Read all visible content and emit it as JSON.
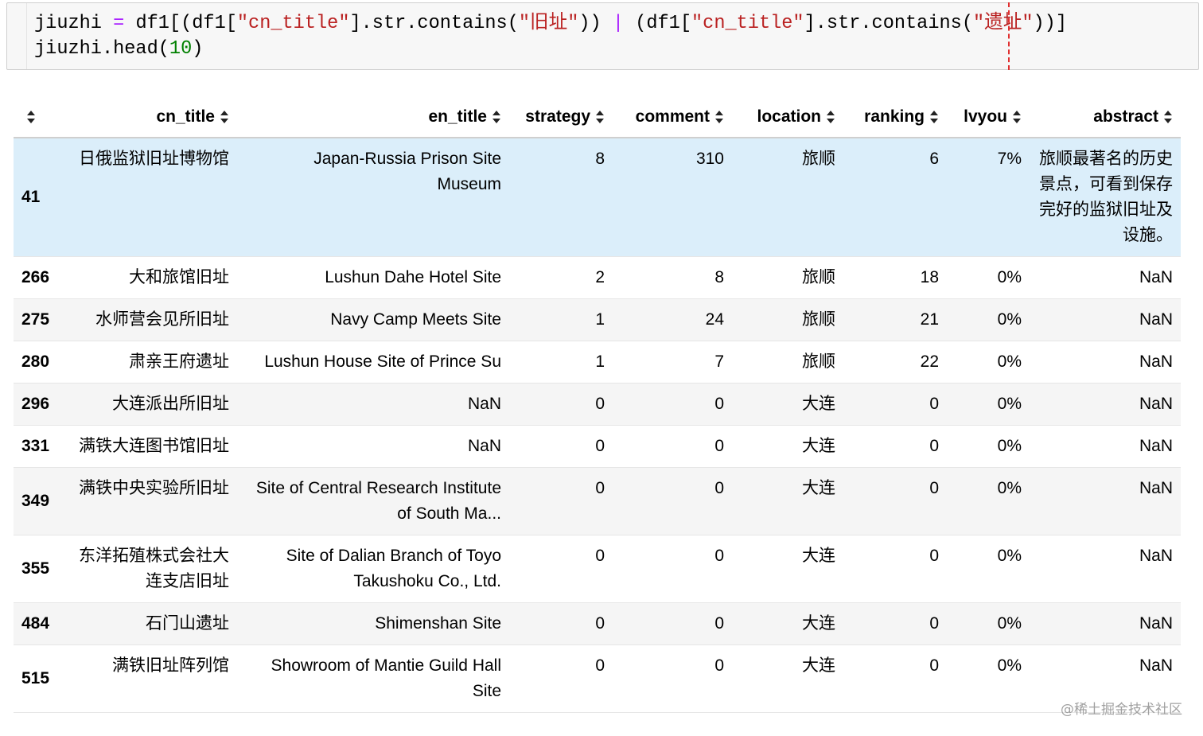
{
  "code": {
    "line1": {
      "t1": "jiuzhi ",
      "t2": "=",
      "t3": " df1[(df1[",
      "t4": "\"cn_title\"",
      "t5": "].str.contains(",
      "t6": "\"旧址\"",
      "t7": ")) ",
      "t8": "|",
      "t9": " (df1[",
      "t10": "\"cn_title\"",
      "t11": "].str.contains(",
      "t12": "\"遗址\"",
      "t13": "))]"
    },
    "line2": {
      "t1": "jiuzhi.head(",
      "t2": "10",
      "t3": ")"
    }
  },
  "table": {
    "columns": [
      "cn_title",
      "en_title",
      "strategy",
      "comment",
      "location",
      "ranking",
      "lvyou",
      "abstract"
    ],
    "rows": [
      {
        "index": "41",
        "cn_title": "日俄监狱旧址博物馆",
        "en_title": "Japan-Russia Prison Site Museum",
        "strategy": "8",
        "comment": "310",
        "location": "旅顺",
        "ranking": "6",
        "lvyou": "7%",
        "abstract": "旅顺最著名的历史景点，可看到保存完好的监狱旧址及设施。"
      },
      {
        "index": "266",
        "cn_title": "大和旅馆旧址",
        "en_title": "Lushun Dahe Hotel Site",
        "strategy": "2",
        "comment": "8",
        "location": "旅顺",
        "ranking": "18",
        "lvyou": "0%",
        "abstract": "NaN"
      },
      {
        "index": "275",
        "cn_title": "水师营会见所旧址",
        "en_title": "Navy Camp Meets Site",
        "strategy": "1",
        "comment": "24",
        "location": "旅顺",
        "ranking": "21",
        "lvyou": "0%",
        "abstract": "NaN"
      },
      {
        "index": "280",
        "cn_title": "肃亲王府遗址",
        "en_title": "Lushun House Site of Prince Su",
        "strategy": "1",
        "comment": "7",
        "location": "旅顺",
        "ranking": "22",
        "lvyou": "0%",
        "abstract": "NaN"
      },
      {
        "index": "296",
        "cn_title": "大连派出所旧址",
        "en_title": "NaN",
        "strategy": "0",
        "comment": "0",
        "location": "大连",
        "ranking": "0",
        "lvyou": "0%",
        "abstract": "NaN"
      },
      {
        "index": "331",
        "cn_title": "满铁大连图书馆旧址",
        "en_title": "NaN",
        "strategy": "0",
        "comment": "0",
        "location": "大连",
        "ranking": "0",
        "lvyou": "0%",
        "abstract": "NaN"
      },
      {
        "index": "349",
        "cn_title": "满铁中央实验所旧址",
        "en_title": "Site of Central Research Institute of South Ma...",
        "strategy": "0",
        "comment": "0",
        "location": "大连",
        "ranking": "0",
        "lvyou": "0%",
        "abstract": "NaN"
      },
      {
        "index": "355",
        "cn_title": "东洋拓殖株式会社大连支店旧址",
        "en_title": "Site of Dalian Branch of Toyo Takushoku Co., Ltd.",
        "strategy": "0",
        "comment": "0",
        "location": "大连",
        "ranking": "0",
        "lvyou": "0%",
        "abstract": "NaN"
      },
      {
        "index": "484",
        "cn_title": "石门山遗址",
        "en_title": "Shimenshan Site",
        "strategy": "0",
        "comment": "0",
        "location": "大连",
        "ranking": "0",
        "lvyou": "0%",
        "abstract": "NaN"
      },
      {
        "index": "515",
        "cn_title": "满铁旧址阵列馆",
        "en_title": "Showroom of Mantie Guild Hall Site",
        "strategy": "0",
        "comment": "0",
        "location": "大连",
        "ranking": "0",
        "lvyou": "0%",
        "abstract": "NaN"
      }
    ]
  },
  "watermark": "@稀土掘金技术社区",
  "colors": {
    "string": "#ba2121",
    "operator": "#aa22ff",
    "number": "#008000",
    "selected_row": "#dbeefa",
    "ruler": "#e03030"
  },
  "icons": {
    "sort": "sort-arrows-icon"
  }
}
